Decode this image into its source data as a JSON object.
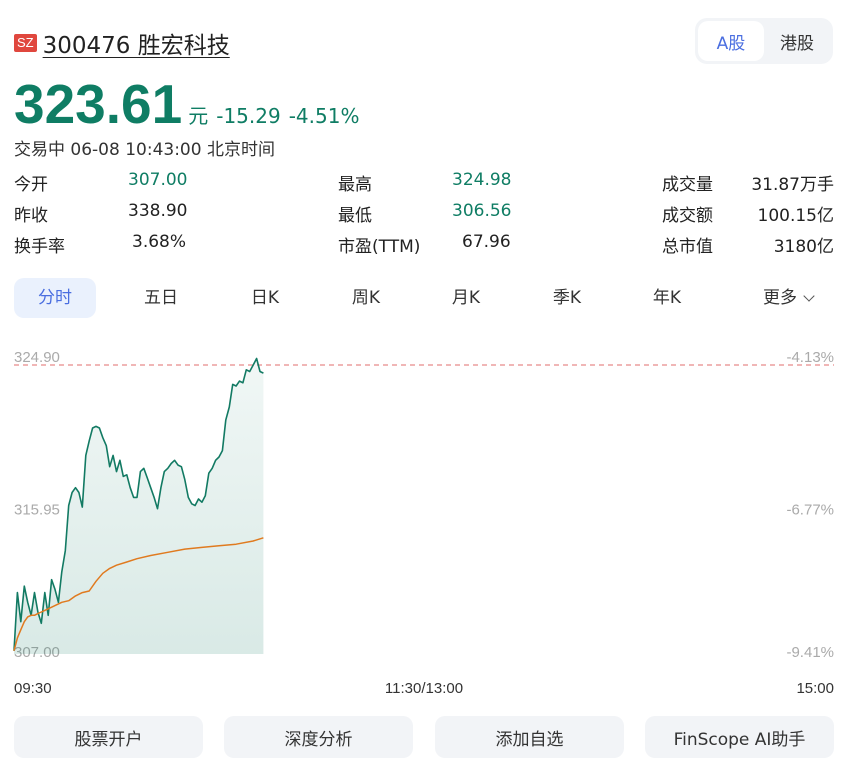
{
  "header": {
    "exchange": "SZ",
    "ticker": "300476 胜宏科技",
    "market_tabs": [
      {
        "label": "A股",
        "active": true
      },
      {
        "label": "港股",
        "active": false
      }
    ]
  },
  "quote": {
    "price": "323.61",
    "unit": "元",
    "change": "-15.29",
    "change_pct": "-4.51%",
    "status": "交易中 06-08 10:43:00 北京时间",
    "color_down": "#0f7d64"
  },
  "stats": [
    [
      {
        "label": "今开",
        "value": "307.00",
        "green": true
      },
      {
        "label": "最高",
        "value": "324.98",
        "green": true
      },
      {
        "label": "成交量",
        "value": "31.87万手",
        "green": false
      }
    ],
    [
      {
        "label": "昨收",
        "value": "338.90",
        "green": false
      },
      {
        "label": "最低",
        "value": "306.56",
        "green": true
      },
      {
        "label": "成交额",
        "value": "100.15亿",
        "green": false
      }
    ],
    [
      {
        "label": "换手率",
        "value": "3.68%",
        "green": false
      },
      {
        "label": "市盈(TTM)",
        "value": "67.96",
        "green": false
      },
      {
        "label": "总市值",
        "value": "3180亿",
        "green": false
      }
    ]
  ],
  "period_tabs": [
    {
      "label": "分时",
      "active": true
    },
    {
      "label": "五日",
      "active": false
    },
    {
      "label": "日K",
      "active": false
    },
    {
      "label": "周K",
      "active": false
    },
    {
      "label": "月K",
      "active": false
    },
    {
      "label": "季K",
      "active": false
    },
    {
      "label": "年K",
      "active": false
    },
    {
      "label": "更多",
      "active": false
    }
  ],
  "chart_data": {
    "type": "line",
    "y_labels_left": [
      "324.90",
      "315.95",
      "307.00"
    ],
    "y_labels_right": [
      "-4.13%",
      "-6.77%",
      "-9.41%"
    ],
    "ylim": [
      307.0,
      324.9
    ],
    "x_labels": [
      "09:30",
      "11:30/13:00",
      "15:00"
    ],
    "total_minutes": 240,
    "reference_line": {
      "value": 324.9,
      "style": "dashed",
      "color": "#e88a8a"
    },
    "series": [
      {
        "color": "#127a63",
        "x": [
          0,
          1,
          2,
          3,
          4,
          5,
          6,
          7,
          8,
          9,
          10,
          11,
          12,
          13,
          14,
          15,
          16,
          17,
          18,
          19,
          20,
          21,
          22,
          23,
          24,
          25,
          26,
          27,
          28,
          29,
          30,
          31,
          32,
          33,
          34,
          35,
          36,
          37,
          38,
          39,
          40,
          41,
          42,
          43,
          44,
          45,
          46,
          47,
          48,
          49,
          50,
          51,
          52,
          53,
          54,
          55,
          56,
          57,
          58,
          59,
          60,
          61,
          62,
          63,
          64,
          65,
          66,
          67,
          68,
          69,
          70,
          71,
          72,
          73
        ],
        "values": [
          307.2,
          310.8,
          309.0,
          311.2,
          310.2,
          309.4,
          310.8,
          309.6,
          308.9,
          310.8,
          309.4,
          311.6,
          311.0,
          310.2,
          312.1,
          313.4,
          316.2,
          317.0,
          317.3,
          317.0,
          316.1,
          319.3,
          320.2,
          321.0,
          321.1,
          321.0,
          320.4,
          319.9,
          318.6,
          319.3,
          318.3,
          319.0,
          318.0,
          318.1,
          317.3,
          316.7,
          316.7,
          318.3,
          318.5,
          317.9,
          317.3,
          316.7,
          316.0,
          317.3,
          318.3,
          318.5,
          318.8,
          319.0,
          318.7,
          318.6,
          317.8,
          316.7,
          316.3,
          316.2,
          316.6,
          316.4,
          316.8,
          318.2,
          318.5,
          319.0,
          319.2,
          319.6,
          321.5,
          322.3,
          323.7,
          323.6,
          323.9,
          323.8,
          324.6,
          324.5,
          324.9,
          325.3,
          324.5,
          324.4
        ]
      },
      {
        "color": "#e07a1f",
        "x": [
          0,
          1,
          2,
          3,
          4,
          5,
          6,
          7,
          8,
          9,
          10,
          12,
          14,
          16,
          18,
          20,
          22,
          24,
          26,
          28,
          30,
          33,
          36,
          40,
          45,
          50,
          55,
          60,
          65,
          70,
          73
        ],
        "values": [
          307.2,
          308.0,
          308.5,
          309.0,
          309.3,
          309.4,
          309.4,
          309.5,
          309.6,
          309.7,
          309.8,
          310.0,
          310.2,
          310.3,
          310.6,
          310.8,
          310.9,
          311.5,
          312.0,
          312.3,
          312.5,
          312.7,
          312.9,
          313.1,
          313.3,
          313.5,
          313.6,
          313.7,
          313.8,
          314.0,
          314.2
        ]
      }
    ]
  },
  "actions": [
    "股票开户",
    "深度分析",
    "添加自选",
    "FinScope AI助手"
  ]
}
